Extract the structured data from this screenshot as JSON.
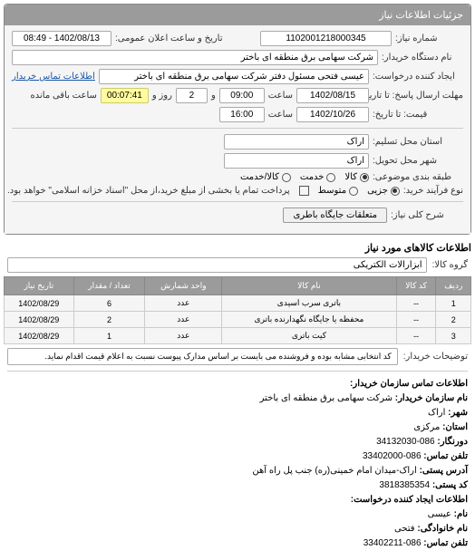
{
  "panel": {
    "title": "جزئیات اطلاعات نیاز"
  },
  "fields": {
    "need_no_label": "شماره نیاز:",
    "need_no": "1102001218000345",
    "publish_label": "تاریخ و ساعت اعلان عمومی:",
    "publish_value": "1402/08/13 - 08:49",
    "buyer_org_label": "نام دستگاه خریدار:",
    "buyer_org": "شرکت سهامی برق منطقه ای باختر",
    "creator_label": "ایجاد کننده درخواست:",
    "creator": "عیسی فتحی مسئول دفتر شرکت سهامی برق منطقه ای باختر",
    "contact_link": "اطلاعات تماس خریدار",
    "deadline_label": "مهلت ارسال پاسخ: تا تاریخ:",
    "deadline_date": "1402/08/15",
    "time_label": "ساعت",
    "deadline_time": "09:00",
    "remaining_label_prefix": "و",
    "remaining_days": "2",
    "remaining_label_mid": "روز و",
    "remaining_time": "00:07:41",
    "remaining_label_suffix": "ساعت باقی مانده",
    "price_until_label": "قیمت: تا تاریخ:",
    "price_until_date": "1402/10/26",
    "price_until_time": "16:00",
    "province_label": "استان محل تسلیم:",
    "province": "اراک",
    "city_label": "شهر محل تحویل:",
    "city": "اراک",
    "category_label": "طبقه بندی موضوعی:",
    "cat_goods": "کالا",
    "cat_service": "خدمت",
    "cat_goods_service": "کالا/خدمت",
    "process_label": "نوع فرآیند خرید:",
    "proc_small": "جزیی",
    "proc_medium": "متوسط",
    "proc_note": "پرداخت تمام یا بخشی از مبلغ خرید،از محل \"اسناد خزانه اسلامی\" خواهد بود.",
    "need_title_label": "شرح کلی نیاز:",
    "need_title_button": "متعلقات جایگاه باطری"
  },
  "goods_section_title": "اطلاعات کالاهای مورد نیاز",
  "group_label": "گروه کالا:",
  "group_value": "ابزارآلات الکتریکی",
  "table": {
    "headers": {
      "row": "ردیف",
      "code": "کد کالا",
      "name": "نام کالا",
      "unit": "واحد شمارش",
      "qty": "تعداد / مقدار",
      "date": "تاریخ نیاز"
    },
    "rows": [
      {
        "row": "1",
        "code": "--",
        "name": "باتری سرب اسیدی",
        "unit": "عدد",
        "qty": "6",
        "date": "1402/08/29"
      },
      {
        "row": "2",
        "code": "--",
        "name": "محفظه یا جایگاه نگهدارنده باتری",
        "unit": "عدد",
        "qty": "2",
        "date": "1402/08/29"
      },
      {
        "row": "3",
        "code": "--",
        "name": "کیت باتری",
        "unit": "عدد",
        "qty": "1",
        "date": "1402/08/29"
      }
    ]
  },
  "buyer_desc_label": "توضیحات خریدار:",
  "buyer_desc": "کد انتخابی مشابه بوده و فروشنده می بایست بر اساس مدارک پیوست نسبت به اعلام قیمت اقدام نماید.",
  "contact_section_title": "اطلاعات تماس سازمان خریدار:",
  "contact": {
    "org_label": "نام سازمان خریدار:",
    "org": "شرکت سهامی برق منطقه ای باختر",
    "city_label": "شهر:",
    "city": "اراک",
    "province_label": "استان:",
    "province": "مرکزی",
    "fax_label": "دورنگار:",
    "fax": "086-34132030",
    "phone_label": "تلفن تماس:",
    "phone": "086-33402000",
    "address_label": "آدرس پستی:",
    "address": "اراک-میدان امام خمینی(ره) جنب پل راه آهن",
    "postcode_label": "کد پستی:",
    "postcode": "3818385354",
    "req_creator_title": "اطلاعات ایجاد کننده درخواست:",
    "first_label": "نام:",
    "first": "عیسی",
    "last_label": "نام خانوادگی:",
    "last": "فتحی",
    "tel_label": "تلفن تماس:",
    "tel": "086-33402211"
  }
}
